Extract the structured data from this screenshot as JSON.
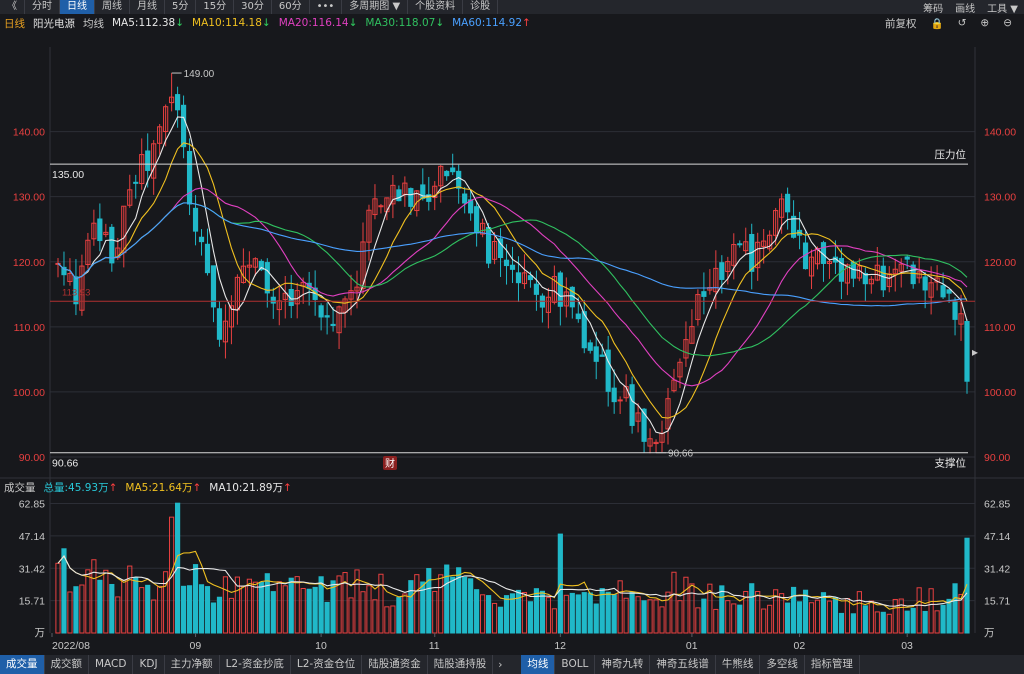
{
  "toolbar": {
    "back": "《",
    "items": [
      "分时",
      "日线",
      "周线",
      "月线",
      "5分",
      "15分",
      "30分",
      "60分",
      "•••",
      "多周期图 ▼",
      "个股资料",
      "诊股"
    ],
    "active_index": 1,
    "right_items": [
      "筹码",
      "画线",
      "工具 ▼"
    ]
  },
  "info": {
    "period": "日线",
    "stock_name": "阳光电源",
    "ma_label": "均线",
    "ma5": "MA5:112.38",
    "ma10": "MA10:114.18",
    "ma20": "MA20:116.14",
    "ma30": "MA30:118.07",
    "ma60": "MA60:114.92",
    "arrow_down": "↓",
    "arrow_up": "↑",
    "right_label": "前复权"
  },
  "volume_header": {
    "title": "成交量",
    "total": "总量:45.93万",
    "ma5": "MA5:21.64万",
    "ma10": "MA10:21.89万",
    "arrow": "↑"
  },
  "bottom_tabs": [
    "成交量",
    "成交额",
    "MACD",
    "KDJ",
    "主力净额",
    "L2-资金抄底",
    "L2-资金仓位",
    "陆股通资金",
    "陆股通持股"
  ],
  "bottom_tabs_right": [
    "均线",
    "BOLL",
    "神奇九转",
    "神奇五线谱",
    "牛熊线",
    "多空线",
    "指标管理"
  ],
  "bottom_active_left": 0,
  "bottom_active_right": 0,
  "annotations": {
    "high": "149.00",
    "low": "90.66",
    "resistance_value": "135.00",
    "resistance_label": "压力位",
    "support_value": "90.66",
    "support_label": "支撑位",
    "red_line_value": "113.93",
    "fin_badge": "财"
  },
  "colors": {
    "up": "#e84040",
    "down": "#20b8c8",
    "ma5": "#e8e8e8",
    "ma10": "#f0c020",
    "ma20": "#e040c0",
    "ma30": "#30c060",
    "ma60": "#4aa0ff",
    "active": "#1f5fa8"
  },
  "chart_data": {
    "type": "candlestick",
    "price_axis": {
      "ticks": [
        "140.00",
        "130.00",
        "120.00",
        "110.00",
        "100.00",
        "90.00"
      ],
      "range": [
        88,
        153
      ]
    },
    "volume_axis": {
      "ticks": [
        "62.85",
        "47.14",
        "31.42",
        "15.71",
        "万"
      ],
      "range": [
        0,
        66
      ]
    },
    "x_labels": [
      "2022/08",
      "09",
      "10",
      "11",
      "12",
      "01",
      "02",
      "03"
    ],
    "x_label_positions_index": [
      0,
      23,
      44,
      63,
      84,
      106,
      124,
      142
    ],
    "price_keypoints": [
      [
        0,
        119
      ],
      [
        3,
        115
      ],
      [
        6,
        125
      ],
      [
        9,
        121
      ],
      [
        13,
        133
      ],
      [
        16,
        137
      ],
      [
        19,
        145
      ],
      [
        20,
        143
      ],
      [
        22,
        130
      ],
      [
        25,
        118
      ],
      [
        27,
        110
      ],
      [
        29,
        114
      ],
      [
        32,
        120
      ],
      [
        35,
        115
      ],
      [
        37,
        113
      ],
      [
        40,
        117
      ],
      [
        43,
        114
      ],
      [
        45,
        112
      ],
      [
        47,
        112
      ],
      [
        50,
        118
      ],
      [
        52,
        127
      ],
      [
        55,
        130
      ],
      [
        58,
        131
      ],
      [
        60,
        129
      ],
      [
        63,
        132
      ],
      [
        66,
        135
      ],
      [
        68,
        131
      ],
      [
        70,
        126
      ],
      [
        72,
        122
      ],
      [
        75,
        118
      ],
      [
        78,
        116
      ],
      [
        80,
        115
      ],
      [
        83,
        116
      ],
      [
        86,
        113
      ],
      [
        88,
        105
      ],
      [
        91,
        103
      ],
      [
        94,
        100
      ],
      [
        97,
        96
      ],
      [
        99,
        93
      ],
      [
        100,
        92
      ],
      [
        102,
        98
      ],
      [
        104,
        104
      ],
      [
        106,
        110
      ],
      [
        108,
        115
      ],
      [
        110,
        119
      ],
      [
        112,
        120
      ],
      [
        114,
        121
      ],
      [
        117,
        121
      ],
      [
        119,
        126
      ],
      [
        121,
        128
      ],
      [
        123,
        124
      ],
      [
        125,
        121
      ],
      [
        128,
        120
      ],
      [
        131,
        119
      ],
      [
        134,
        117
      ],
      [
        136,
        116
      ],
      [
        139,
        119
      ],
      [
        142,
        119
      ],
      [
        144,
        118
      ],
      [
        146,
        117
      ],
      [
        148,
        115
      ],
      [
        150,
        113
      ],
      [
        151,
        110
      ],
      [
        152,
        104
      ]
    ],
    "volume_keypoints": [
      [
        0,
        30
      ],
      [
        5,
        28
      ],
      [
        10,
        26
      ],
      [
        15,
        27
      ],
      [
        18,
        25
      ],
      [
        20,
        63
      ],
      [
        21,
        30
      ],
      [
        25,
        24
      ],
      [
        30,
        22
      ],
      [
        35,
        22
      ],
      [
        40,
        23
      ],
      [
        45,
        20
      ],
      [
        50,
        22
      ],
      [
        55,
        21
      ],
      [
        60,
        22
      ],
      [
        65,
        24
      ],
      [
        70,
        22
      ],
      [
        75,
        20
      ],
      [
        80,
        19
      ],
      [
        85,
        18
      ],
      [
        88,
        20
      ],
      [
        90,
        22
      ],
      [
        92,
        20
      ],
      [
        95,
        18
      ],
      [
        100,
        19
      ],
      [
        104,
        24
      ],
      [
        107,
        20
      ],
      [
        110,
        19
      ],
      [
        115,
        18
      ],
      [
        120,
        18
      ],
      [
        125,
        17
      ],
      [
        130,
        16
      ],
      [
        135,
        15
      ],
      [
        140,
        15
      ],
      [
        145,
        16
      ],
      [
        148,
        18
      ],
      [
        150,
        20
      ],
      [
        151,
        22
      ],
      [
        152,
        46
      ]
    ],
    "candle_count": 153
  }
}
